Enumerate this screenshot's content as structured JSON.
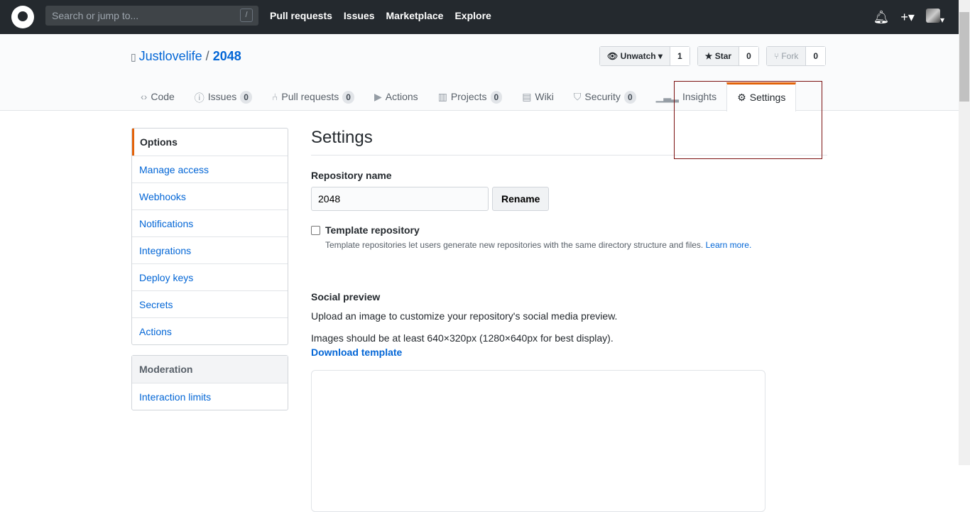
{
  "topbar": {
    "search_placeholder": "Search or jump to...",
    "slash": "/",
    "nav": [
      "Pull requests",
      "Issues",
      "Marketplace",
      "Explore"
    ]
  },
  "repo": {
    "owner": "Justlovelife",
    "sep": "/",
    "name": "2048"
  },
  "actions": {
    "watch": "Unwatch",
    "watch_count": "1",
    "star": "Star",
    "star_count": "0",
    "fork": "Fork",
    "fork_count": "0"
  },
  "tabs": [
    {
      "label": "Code",
      "icon": "code-icon"
    },
    {
      "label": "Issues",
      "count": "0",
      "icon": "issue-icon"
    },
    {
      "label": "Pull requests",
      "count": "0",
      "icon": "pr-icon"
    },
    {
      "label": "Actions",
      "icon": "play-icon"
    },
    {
      "label": "Projects",
      "count": "0",
      "icon": "project-icon"
    },
    {
      "label": "Wiki",
      "icon": "book-icon"
    },
    {
      "label": "Security",
      "count": "0",
      "icon": "shield-icon"
    },
    {
      "label": "Insights",
      "icon": "graph-icon"
    },
    {
      "label": "Settings",
      "icon": "gear-icon",
      "selected": true
    }
  ],
  "sidebar": {
    "items": [
      "Options",
      "Manage access",
      "Webhooks",
      "Notifications",
      "Integrations",
      "Deploy keys",
      "Secrets",
      "Actions"
    ],
    "moderation": "Moderation",
    "moderation_items": [
      "Interaction limits"
    ]
  },
  "main": {
    "title": "Settings",
    "repo_name_label": "Repository name",
    "repo_name_value": "2048",
    "rename": "Rename",
    "template_label": "Template repository",
    "template_note": "Template repositories let users generate new repositories with the same directory structure and files.",
    "learn_more": "Learn more.",
    "social_title": "Social preview",
    "social_desc": "Upload an image to customize your repository's social media preview.",
    "social_size": "Images should be at least 640×320px (1280×640px for best display).",
    "download": "Download template"
  },
  "colors": {
    "accent": "#e36209",
    "link": "#0366d6",
    "header": "#24292e"
  }
}
